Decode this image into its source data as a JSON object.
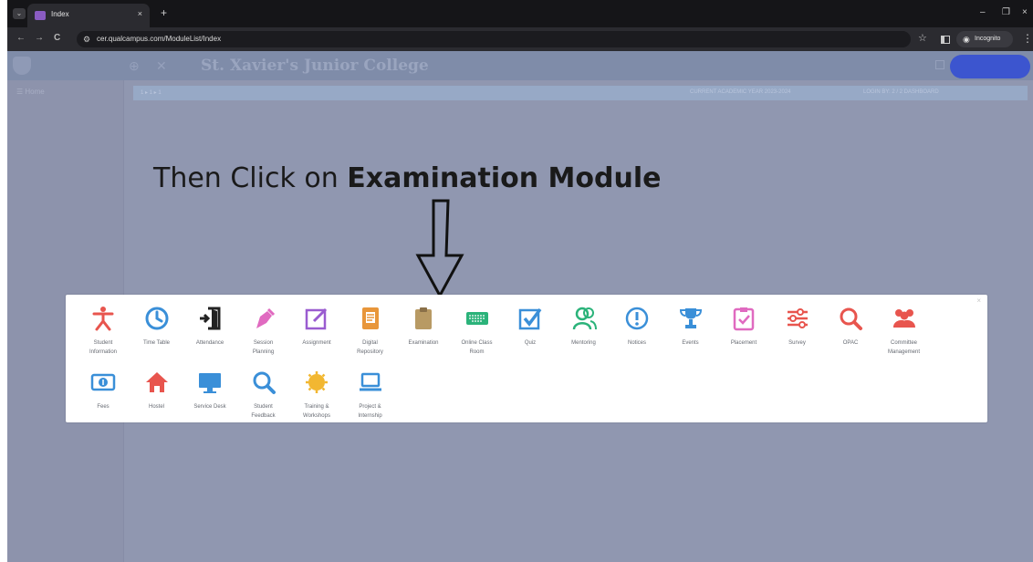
{
  "browser": {
    "tab_title": "Index",
    "tab_close": "×",
    "new_tab": "+",
    "url": "cer.qualcampus.com/ModuleList/Index",
    "incognito_label": "Incognito",
    "window": {
      "minimize": "–",
      "restore": "❐",
      "close": "×"
    },
    "nav": {
      "back": "←",
      "forward": "→",
      "reload": "C",
      "star": "☆",
      "menu": "⋮"
    }
  },
  "app": {
    "college_name": "St. Xavier's Junior College",
    "sidebar_item": "☰  Home",
    "info_strip_left": "1 ▸ 1 ▸ 1",
    "info_strip_mid": "CURRENT ACADEMIC YEAR 2023-2024",
    "info_strip_right": "LOGIN BY: 2 / 2 DASHBOARD"
  },
  "instruction": {
    "prefix": "Then Click on ",
    "emphasis": "Examination Module"
  },
  "modules_row1": [
    {
      "label": "Student\nInformation",
      "icon": "student-icon",
      "color": "#e8554e"
    },
    {
      "label": "Time Table",
      "icon": "clock-icon",
      "color": "#3a8fd8"
    },
    {
      "label": "Attendance",
      "icon": "attendance-door-icon",
      "color": "#222222"
    },
    {
      "label": "Session\nPlanning",
      "icon": "pen-nib-icon",
      "color": "#e06ac0"
    },
    {
      "label": "Assignment",
      "icon": "edit-square-icon",
      "color": "#9a5cd0"
    },
    {
      "label": "Digital\nRepository",
      "icon": "document-icon",
      "color": "#e8963a"
    },
    {
      "label": "Examination",
      "icon": "clipboard-icon",
      "color": "#b89a64"
    },
    {
      "label": "Online Class\nRoom",
      "icon": "keyboard-icon",
      "color": "#2bb37a"
    },
    {
      "label": "Quiz",
      "icon": "checkbox-icon",
      "color": "#3a8fd8"
    },
    {
      "label": "Mentoring",
      "icon": "mentoring-icon",
      "color": "#2bb37a"
    },
    {
      "label": "Notices",
      "icon": "alert-circle-icon",
      "color": "#3a8fd8"
    },
    {
      "label": "Events",
      "icon": "trophy-icon",
      "color": "#3a8fd8"
    },
    {
      "label": "Placement",
      "icon": "clipboard-check-icon",
      "color": "#e06ac0"
    },
    {
      "label": "Survey",
      "icon": "sliders-icon",
      "color": "#e8554e"
    },
    {
      "label": "OPAC",
      "icon": "magnifier-icon",
      "color": "#e8554e"
    },
    {
      "label": "Committee\nManagement",
      "icon": "group-icon",
      "color": "#e8554e"
    }
  ],
  "modules_row2": [
    {
      "label": "Fees",
      "icon": "money-icon",
      "color": "#3a8fd8"
    },
    {
      "label": "Hostel",
      "icon": "home-icon",
      "color": "#e8554e"
    },
    {
      "label": "Service Desk",
      "icon": "monitor-icon",
      "color": "#3a8fd8"
    },
    {
      "label": "Student\nFeedback",
      "icon": "search-icon",
      "color": "#3a8fd8"
    },
    {
      "label": "Training &\nWorkshops",
      "icon": "sun-badge-icon",
      "color": "#f2b731"
    },
    {
      "label": "Project &\nInternship",
      "icon": "laptop-icon",
      "color": "#3a8fd8"
    }
  ]
}
